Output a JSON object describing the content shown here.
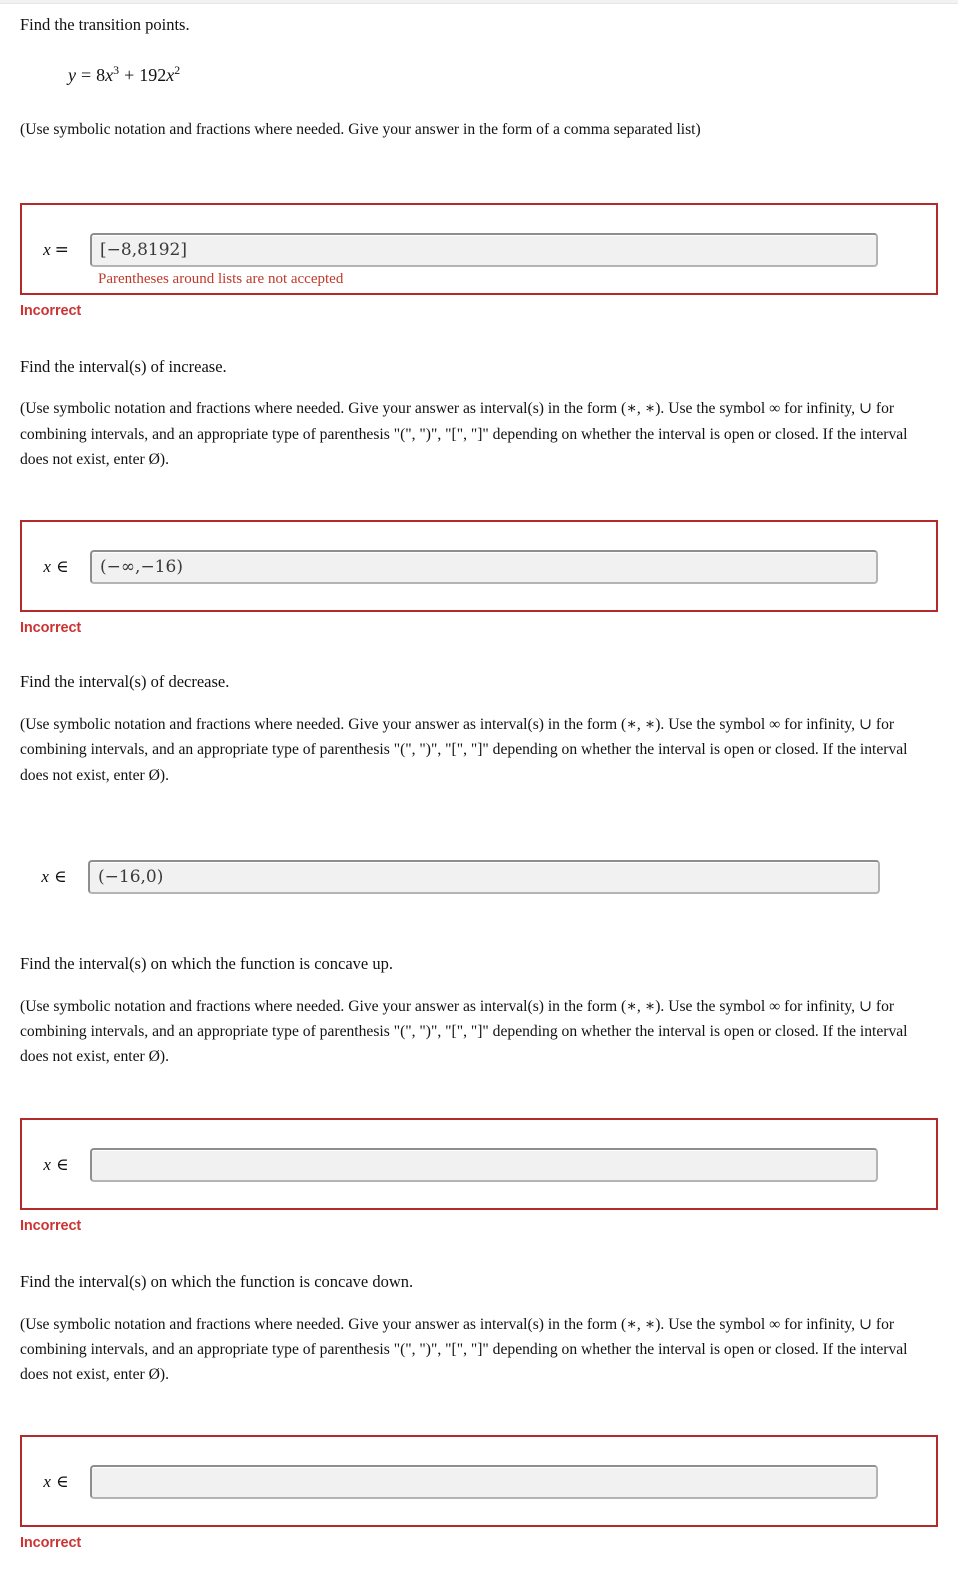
{
  "page": {
    "shared_interval_instructions": "(Use symbolic notation and fractions where needed. Give your answer as interval(s) in the form (∗, ∗). Use the symbol ∞ for infinity, ∪ for combining intervals, and an appropriate type of parenthesis \"(\", \")\", \"[\", \"]\" depending on whether the interval is open or closed. If the interval does not exist, enter Ø).",
    "verdict_incorrect": "Incorrect"
  },
  "colors": {
    "flag_border": "#b32a2a",
    "verdict_red": "#cc3333",
    "field_error_red": "#c0392b",
    "field_fill": "#f1f1f1",
    "field_border": "#9e9e9e"
  },
  "questions": [
    {
      "id": "transition-points",
      "prompt": "Find the transition points.",
      "equation_lhs": "y",
      "equation_rel": "=",
      "equation_term1_coef": "8",
      "equation_term1_var": "x",
      "equation_term1_exp": "3",
      "equation_plus": "+",
      "equation_term2_coef": "192",
      "equation_term2_var": "x",
      "equation_term2_exp": "2",
      "instructions": "(Use symbolic notation and fractions where needed. Give your answer in the form of a comma separated list)",
      "var_label": "x",
      "relation": "=",
      "answer_value": "[−8,8192]",
      "field_error": "Parentheses around lists are not accepted",
      "flagged": true,
      "verdict": "Incorrect"
    },
    {
      "id": "interval-increase",
      "prompt": "Find the interval(s) of increase.",
      "var_label": "x",
      "relation": "∈",
      "answer_value": "(−∞,−16)",
      "field_error": "",
      "flagged": true,
      "verdict": "Incorrect"
    },
    {
      "id": "interval-decrease",
      "prompt": "Find the interval(s) of decrease.",
      "var_label": "x",
      "relation": "∈",
      "answer_value": "(−16,0)",
      "field_error": "",
      "flagged": false,
      "verdict": ""
    },
    {
      "id": "concave-up",
      "prompt": "Find the interval(s) on which the function is concave up.",
      "var_label": "x",
      "relation": "∈",
      "answer_value": "",
      "field_error": "",
      "flagged": true,
      "verdict": "Incorrect"
    },
    {
      "id": "concave-down",
      "prompt": "Find the interval(s) on which the function is concave down.",
      "var_label": "x",
      "relation": "∈",
      "answer_value": "",
      "field_error": "",
      "flagged": true,
      "verdict": "Incorrect"
    }
  ]
}
